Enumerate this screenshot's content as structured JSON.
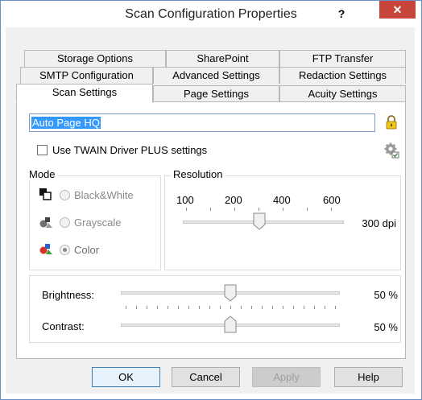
{
  "window": {
    "title": "Scan Configuration Properties",
    "help_label": "?",
    "close_label": "✕"
  },
  "tabs": {
    "row1": [
      "Storage Options",
      "SharePoint",
      "FTP Transfer"
    ],
    "row2": [
      "SMTP Configuration",
      "Advanced Settings",
      "Redaction Settings"
    ],
    "row3": [
      "Scan Settings",
      "Page Settings",
      "Acuity Settings"
    ],
    "active": "Scan Settings"
  },
  "scan_settings": {
    "config_name": "Auto Page HQ",
    "twain_checkbox_label": "Use TWAIN Driver PLUS settings",
    "twain_checked": false,
    "mode": {
      "legend": "Mode",
      "options": [
        "Black&White",
        "Grayscale",
        "Color"
      ],
      "selected": "Color"
    },
    "resolution": {
      "legend": "Resolution",
      "tick_labels": [
        "100",
        "200",
        "400",
        "600"
      ],
      "value_dpi": 300,
      "value_label": "300 dpi"
    },
    "brightness": {
      "label": "Brightness:",
      "value_percent": 50,
      "value_label": "50 %"
    },
    "contrast": {
      "label": "Contrast:",
      "value_percent": 50,
      "value_label": "50 %"
    }
  },
  "buttons": {
    "ok": "OK",
    "cancel": "Cancel",
    "apply": "Apply",
    "help": "Help"
  },
  "colors": {
    "close_button": "#c7453a",
    "selection": "#3399ff",
    "accent_border": "#7a9ccc"
  }
}
